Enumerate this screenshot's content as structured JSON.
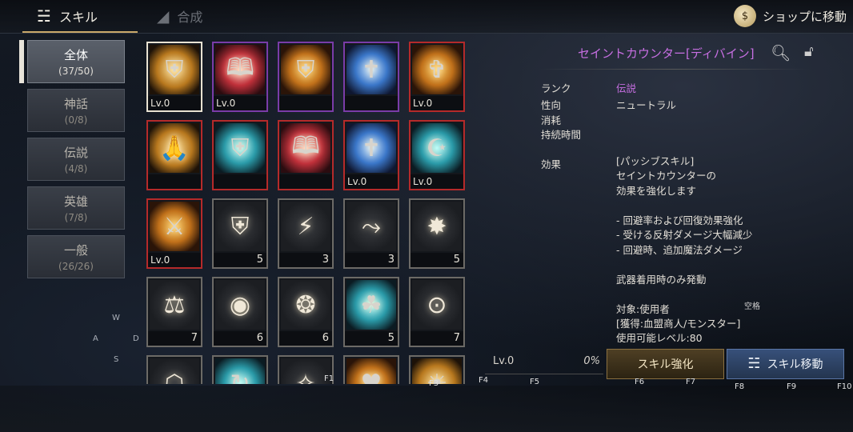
{
  "tabs": [
    {
      "label": "スキル",
      "icon": "skill-swirl-icon"
    },
    {
      "label": "合成",
      "icon": "synthesis-icon"
    }
  ],
  "shop": {
    "label": "ショップに移動",
    "icon": "shop-bag-icon"
  },
  "categories": [
    {
      "name": "全体",
      "count": "(37/50)"
    },
    {
      "name": "神話",
      "count": "(0/8)"
    },
    {
      "name": "伝説",
      "count": "(4/8)"
    },
    {
      "name": "英雄",
      "count": "(7/8)"
    },
    {
      "name": "一般",
      "count": "(26/26)"
    }
  ],
  "compass": {
    "w": "W",
    "a": "A",
    "s": "S",
    "d": "D"
  },
  "slots": [
    {
      "lv": "Lv.0",
      "num": ""
    },
    {
      "lv": "Lv.0",
      "num": ""
    },
    {
      "lv": "",
      "num": ""
    },
    {
      "lv": "",
      "num": ""
    },
    {
      "lv": "Lv.0",
      "num": ""
    },
    {
      "lv": "",
      "num": ""
    },
    {
      "lv": "",
      "num": ""
    },
    {
      "lv": "",
      "num": ""
    },
    {
      "lv": "Lv.0",
      "num": ""
    },
    {
      "lv": "Lv.0",
      "num": ""
    },
    {
      "lv": "Lv.0",
      "num": ""
    },
    {
      "lv": "",
      "num": "5"
    },
    {
      "lv": "",
      "num": "3"
    },
    {
      "lv": "",
      "num": "3"
    },
    {
      "lv": "",
      "num": "5"
    },
    {
      "lv": "",
      "num": "7"
    },
    {
      "lv": "",
      "num": "6"
    },
    {
      "lv": "",
      "num": "6"
    },
    {
      "lv": "",
      "num": "5"
    },
    {
      "lv": "",
      "num": "7"
    }
  ],
  "detail": {
    "title": "セイントカウンター[ディバイン]",
    "rank_label": "ランク",
    "rank_value": "伝説",
    "tendency_label": "性向",
    "tendency_value": "ニュートラル",
    "cost_label": "消耗",
    "duration_label": "持続時間",
    "effect_label": "効果",
    "effect_lines": [
      "[パッシブスキル]",
      "セイントカウンターの",
      "効果を強化します",
      "",
      "- 回避率および回復効果強化",
      "- 受ける反射ダメージ大幅減少",
      "- 回避時、追加魔法ダメージ",
      "",
      "武器着用時のみ発動",
      "",
      "対象:使用者",
      "[獲得:血盟商人/モンスター]",
      "使用可能レベル:80"
    ],
    "space_hint": "空格"
  },
  "level_bar": {
    "level": "Lv.0",
    "percent": "0%"
  },
  "buttons": {
    "enhance": "スキル強化",
    "move": "スキル移動"
  },
  "fkeys": [
    "F1",
    "F3",
    "F4",
    "F5",
    "F6",
    "F7",
    "F8",
    "F9",
    "F10"
  ]
}
